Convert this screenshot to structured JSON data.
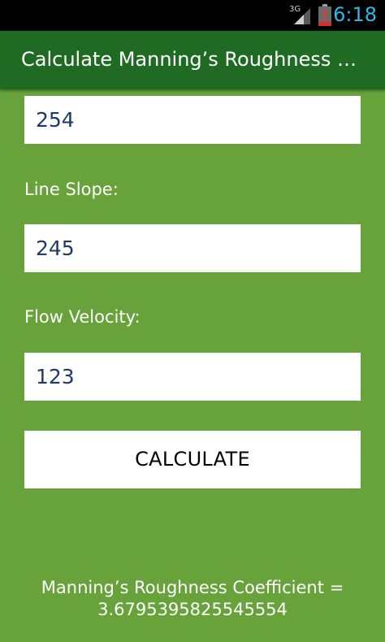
{
  "status_bar": {
    "network": "3G",
    "time": "6:18",
    "signal_icon": "signal-bars-icon",
    "battery_icon": "battery-alert-icon",
    "time_color": "#33b5e5"
  },
  "action_bar": {
    "title": "Calculate Manning’s Roughness C…",
    "background": "#1f6b23"
  },
  "form": {
    "field_top_value": "254",
    "line_slope_label": "Line Slope:",
    "line_slope_value": "245",
    "flow_velocity_label": "Flow Velocity:",
    "flow_velocity_value": "123",
    "calculate_label": "CALCULATE"
  },
  "result": {
    "line1": "Manning’s Roughness Coefficient =",
    "line2": "3.6795395825545554"
  },
  "colors": {
    "content_background": "#68a23a",
    "input_text": "#1d3a6b"
  }
}
